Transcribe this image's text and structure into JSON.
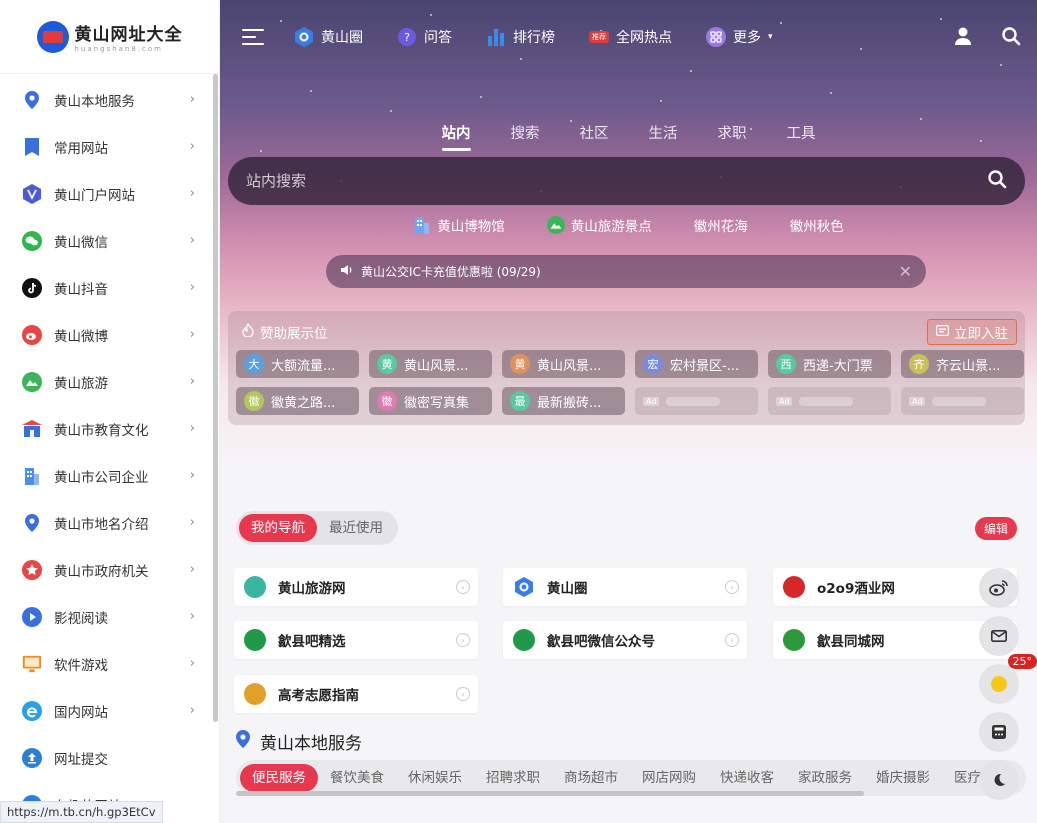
{
  "logo": {
    "text": "黄山网址大全",
    "sub": "huangshan8.com"
  },
  "sidebar": {
    "items": [
      {
        "label": "黄山本地服务",
        "icon": "location-pin-icon",
        "color": "#3a6fe0"
      },
      {
        "label": "常用网站",
        "icon": "bookmark-icon",
        "color": "#3a6fe0"
      },
      {
        "label": "黄山门户网站",
        "icon": "shield-v-icon",
        "color": "#4a5ae0"
      },
      {
        "label": "黄山微信",
        "icon": "wechat-icon",
        "color": "#2db84d"
      },
      {
        "label": "黄山抖音",
        "icon": "tiktok-icon",
        "color": "#111111"
      },
      {
        "label": "黄山微博",
        "icon": "weibo-icon",
        "color": "#e84545"
      },
      {
        "label": "黄山旅游",
        "icon": "mountain-icon",
        "color": "#3ab55a"
      },
      {
        "label": "黄山市教育文化",
        "icon": "school-icon",
        "color": "#3a6fe0"
      },
      {
        "label": "黄山市公司企业",
        "icon": "building-icon",
        "color": "#4d8fe8"
      },
      {
        "label": "黄山市地名介绍",
        "icon": "location-pin-icon",
        "color": "#3a6fe0"
      },
      {
        "label": "黄山市政府机关",
        "icon": "star-badge-icon",
        "color": "#e84545"
      },
      {
        "label": "影视阅读",
        "icon": "play-icon",
        "color": "#3a6fe0"
      },
      {
        "label": "软件游戏",
        "icon": "monitor-icon",
        "color": "#f08a1a"
      },
      {
        "label": "国内网站",
        "icon": "ie-icon",
        "color": "#2aa1e6"
      },
      {
        "label": "网址提交",
        "icon": "upload-icon",
        "color": "#2a7fd8"
      },
      {
        "label": "有趣的网站",
        "icon": "ie-icon",
        "color": "#2a7fd8"
      }
    ]
  },
  "status_url": "https://m.tb.cn/h.gp3EtCv",
  "topbar": {
    "links": [
      {
        "label": "黄山圈",
        "icon": "hexagon-icon",
        "color": "#3a7de8"
      },
      {
        "label": "问答",
        "icon": "question-bubble-icon",
        "color": "#6a5ae0"
      },
      {
        "label": "排行榜",
        "icon": "bar-chart-icon",
        "color": "#3a8ae8"
      },
      {
        "label": "全网热点",
        "icon": "hot-badge-icon",
        "badge": "推荐",
        "color": "#e23b3b"
      },
      {
        "label": "更多",
        "icon": "grid-icon",
        "color": "#9a7ae0"
      }
    ]
  },
  "search": {
    "tabs": [
      "站内",
      "搜索",
      "社区",
      "生活",
      "求职",
      "工具"
    ],
    "active_tab": 0,
    "placeholder": "站内搜索",
    "quick_links": [
      {
        "label": "黄山博物馆",
        "icon": "building-icon"
      },
      {
        "label": "黄山旅游景点",
        "icon": "mountain-icon"
      },
      {
        "label": "徽州花海",
        "icon": ""
      },
      {
        "label": "徽州秋色",
        "icon": ""
      }
    ],
    "notice": "黄山公交IC卡充值优惠啦 (09/29)"
  },
  "sponsor": {
    "title": "赞助展示位",
    "join_label": "立即入驻",
    "items": [
      {
        "avatar": "大",
        "label": "大额流量...",
        "color": "#5aa0e0"
      },
      {
        "avatar": "黄",
        "label": "黄山风景...",
        "color": "#5ac8a0"
      },
      {
        "avatar": "黄",
        "label": "黄山风景...",
        "color": "#e0905a"
      },
      {
        "avatar": "宏",
        "label": "宏村景区-...",
        "color": "#7a8ae0"
      },
      {
        "avatar": "西",
        "label": "西递-大门票",
        "color": "#5ac8a0"
      },
      {
        "avatar": "齐",
        "label": "齐云山景...",
        "color": "#c8c05a"
      },
      {
        "avatar": "徽",
        "label": "徽黄之路...",
        "color": "#b0c85a"
      },
      {
        "avatar": "徽",
        "label": "徽密写真集",
        "color": "#e07ab0"
      },
      {
        "avatar": "最",
        "label": "最新搬砖...",
        "color": "#5ac8a0"
      },
      {
        "ad": "Ad"
      },
      {
        "ad": "Ad"
      },
      {
        "ad": "Ad"
      }
    ]
  },
  "my_nav": {
    "tabs": [
      "我的导航",
      "最近使用"
    ],
    "active_tab": 0,
    "edit_label": "编辑",
    "cards": [
      {
        "label": "黄山旅游网",
        "icon": "huangshan-travel-logo-icon",
        "color": "#3ab5a0"
      },
      {
        "label": "黄山圈",
        "icon": "hexagon-icon",
        "color": "#3a7de8"
      },
      {
        "label": "o2o9酒业网",
        "icon": "wine-logo-icon",
        "color": "#d62828"
      },
      {
        "label": "歙县吧精选",
        "icon": "shexian-logo-icon",
        "color": "#1e9a4a"
      },
      {
        "label": "歙县吧微信公众号",
        "icon": "shexian-logo-icon",
        "color": "#1e9a4a"
      },
      {
        "label": "歙县同城网",
        "icon": "shexian-city-logo-icon",
        "color": "#2a9a3a"
      },
      {
        "label": "高考志愿指南",
        "icon": "gaokao-logo-icon",
        "color": "#e0a02a"
      }
    ]
  },
  "local_section": {
    "title": "黄山本地服务",
    "categories": [
      "便民服务",
      "餐饮美食",
      "休闲娱乐",
      "招聘求职",
      "商场超市",
      "网店网购",
      "快递收客",
      "家政服务",
      "婚庆摄影",
      "医疗健"
    ],
    "active_category": 0
  },
  "floating": {
    "temperature": "25°"
  }
}
